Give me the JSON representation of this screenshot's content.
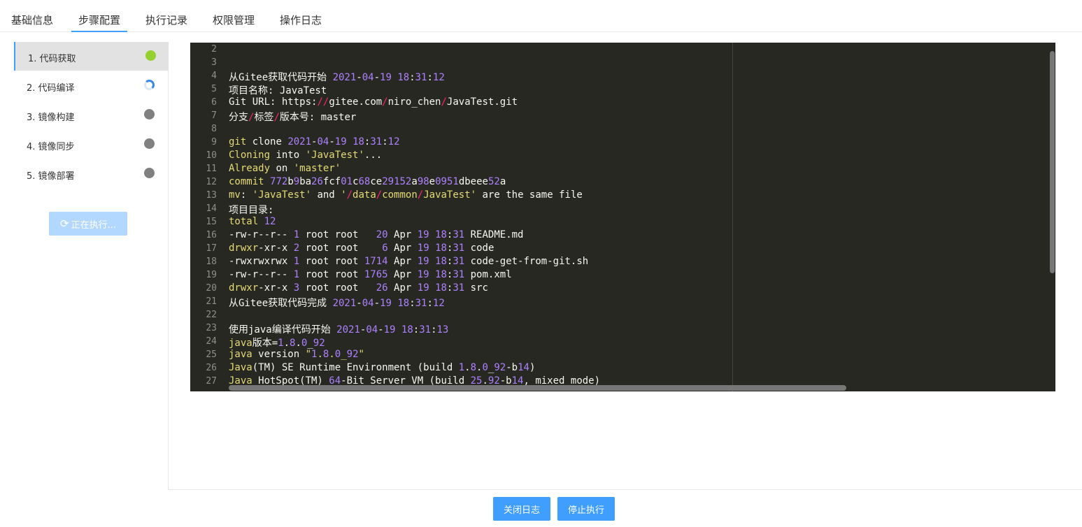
{
  "tabs": [
    {
      "label": "基础信息",
      "active": false
    },
    {
      "label": "步骤配置",
      "active": true
    },
    {
      "label": "执行记录",
      "active": false
    },
    {
      "label": "权限管理",
      "active": false
    },
    {
      "label": "操作日志",
      "active": false
    }
  ],
  "steps": [
    {
      "label": "1. 代码获取",
      "status": "success",
      "status_color": "#95d12e"
    },
    {
      "label": "2. 代码编译",
      "status": "running",
      "status_color": "#3a87e6"
    },
    {
      "label": "3. 镜像构建",
      "status": "pending",
      "status_color": "#808080"
    },
    {
      "label": "4. 镜像同步",
      "status": "pending",
      "status_color": "#808080"
    },
    {
      "label": "5. 镜像部署",
      "status": "pending",
      "status_color": "#808080"
    }
  ],
  "run_button": {
    "icon": "refresh-icon",
    "label": "正在执行..."
  },
  "log": {
    "lines": [
      {
        "n": "2",
        "t": ""
      },
      {
        "n": "3",
        "t": ""
      },
      {
        "n": "4",
        "t": "从Gitee获取代码开始 2021-04-19 18:31:12"
      },
      {
        "n": "5",
        "t": "项目名称: JavaTest"
      },
      {
        "n": "6",
        "t": "Git URL: https://gitee.com/niro_chen/JavaTest.git"
      },
      {
        "n": "7",
        "t": "分支/标签/版本号: master"
      },
      {
        "n": "8",
        "t": ""
      },
      {
        "n": "9",
        "t": "git clone 2021-04-19 18:31:12"
      },
      {
        "n": "10",
        "t": "Cloning into 'JavaTest'..."
      },
      {
        "n": "11",
        "t": "Already on 'master'"
      },
      {
        "n": "12",
        "t": "commit 772b9ba26fcf01c68ce29152a98e0951dbeee52a"
      },
      {
        "n": "13",
        "t": "mv: 'JavaTest' and '/data/common/JavaTest' are the same file"
      },
      {
        "n": "14",
        "t": "项目目录:"
      },
      {
        "n": "15",
        "t": "total 12"
      },
      {
        "n": "16",
        "t": "-rw-r--r-- 1 root root   20 Apr 19 18:31 README.md"
      },
      {
        "n": "17",
        "t": "drwxr-xr-x 2 root root    6 Apr 19 18:31 code"
      },
      {
        "n": "18",
        "t": "-rwxrwxrwx 1 root root 1714 Apr 19 18:31 code-get-from-git.sh"
      },
      {
        "n": "19",
        "t": "-rw-r--r-- 1 root root 1765 Apr 19 18:31 pom.xml"
      },
      {
        "n": "20",
        "t": "drwxr-xr-x 3 root root   26 Apr 19 18:31 src"
      },
      {
        "n": "21",
        "t": "从Gitee获取代码完成 2021-04-19 18:31:12"
      },
      {
        "n": "22",
        "t": ""
      },
      {
        "n": "23",
        "t": "使用java编译代码开始 2021-04-19 18:31:13"
      },
      {
        "n": "24",
        "t": "java版本=1.8.0_92"
      },
      {
        "n": "25",
        "t": "java version \"1.8.0_92\""
      },
      {
        "n": "26",
        "t": "Java(TM) SE Runtime Environment (build 1.8.0_92-b14)"
      },
      {
        "n": "27",
        "t": "Java HotSpot(TM) 64-Bit Server VM (build 25.92-b14, mixed mode)"
      }
    ]
  },
  "footer": {
    "close_log": "关闭日志",
    "stop_exec": "停止执行"
  }
}
